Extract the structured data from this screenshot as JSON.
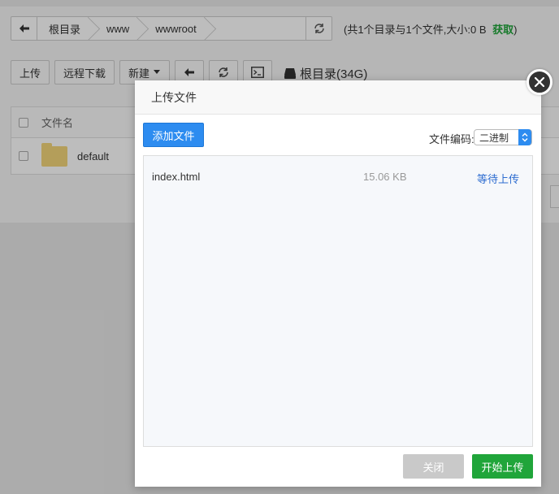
{
  "pathbar": {
    "crumbs": [
      "根目录",
      "www",
      "wwwroot"
    ]
  },
  "summary": {
    "text": "(共1个目录与1个文件,大小:0 B",
    "fetch_label": "获取",
    "close_paren": ")"
  },
  "toolbar": {
    "upload_label": "上传",
    "remote_download_label": "远程下载",
    "new_label": "新建"
  },
  "disk": {
    "label": "根目录(34G)"
  },
  "file_table": {
    "header_name": "文件名",
    "rows": [
      {
        "name": "default",
        "type": "folder"
      }
    ]
  },
  "upload_dialog": {
    "title": "上传文件",
    "add_file_label": "添加文件",
    "encoding_label": "文件编码:",
    "encoding_value": "二进制",
    "files": [
      {
        "name": "index.html",
        "size": "15.06 KB",
        "status": "等待上传"
      }
    ],
    "close_label": "关闭",
    "start_label": "开始上传"
  },
  "colors": {
    "primary_blue": "#2d8cf0",
    "green": "#20a53a",
    "status_blue": "#2d6cd0"
  }
}
